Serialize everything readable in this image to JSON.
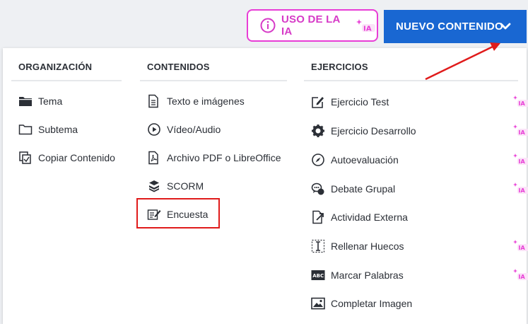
{
  "header": {
    "ia_button_label": "USO DE LA IA",
    "ia_logo_text": "IA",
    "new_content_label": "NUEVO CONTENIDO"
  },
  "columns": {
    "organizacion": {
      "title": "ORGANIZACIÓN",
      "items": [
        {
          "label": "Tema",
          "icon": "folder-filled-icon"
        },
        {
          "label": "Subtema",
          "icon": "folder-outline-icon"
        },
        {
          "label": "Copiar Contenido",
          "icon": "copy-content-icon"
        }
      ]
    },
    "contenidos": {
      "title": "CONTENIDOS",
      "items": [
        {
          "label": "Texto e imágenes",
          "icon": "document-icon"
        },
        {
          "label": "Vídeo/Audio",
          "icon": "play-circle-icon"
        },
        {
          "label": "Archivo PDF o LibreOffice",
          "icon": "pdf-file-icon"
        },
        {
          "label": "SCORM",
          "icon": "scorm-box-icon"
        },
        {
          "label": "Encuesta",
          "icon": "survey-icon"
        }
      ]
    },
    "ejercicios": {
      "title": "EJERCICIOS",
      "items": [
        {
          "label": "Ejercicio Test",
          "icon": "edit-square-icon",
          "ia": true
        },
        {
          "label": "Ejercicio Desarrollo",
          "icon": "gear-icon",
          "ia": true
        },
        {
          "label": "Autoevaluación",
          "icon": "compass-icon",
          "ia": true
        },
        {
          "label": "Debate Grupal",
          "icon": "chat-bubbles-icon",
          "ia": true
        },
        {
          "label": "Actividad Externa",
          "icon": "external-link-icon",
          "ia": false
        },
        {
          "label": "Rellenar Huecos",
          "icon": "text-cursor-icon",
          "ia": true
        },
        {
          "label": "Marcar Palabras",
          "icon": "abc-icon",
          "ia": true
        },
        {
          "label": "Completar Imagen",
          "icon": "image-icon",
          "ia": false
        }
      ]
    }
  },
  "colors": {
    "primary_blue": "#1967d2",
    "ia_magenta": "#e83dd6",
    "annotation_red": "#e01b1b"
  }
}
